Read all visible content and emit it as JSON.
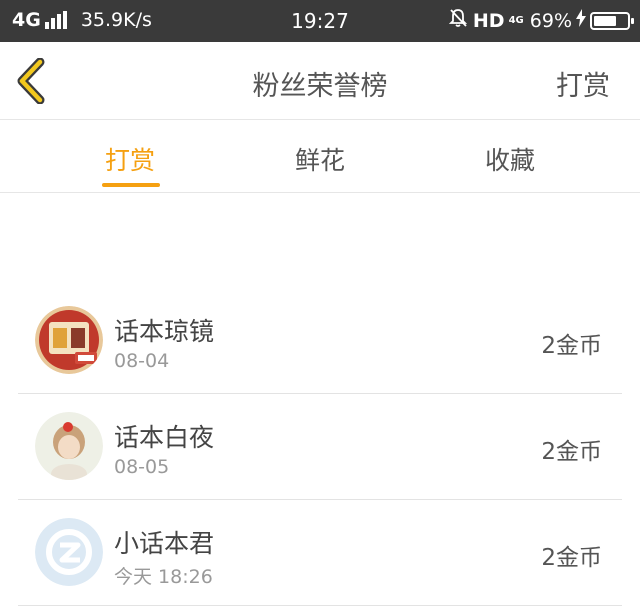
{
  "statusbar": {
    "network": "4G",
    "speed": "35.9K/s",
    "time": "19:27",
    "hd": "HD",
    "network_small": "4G",
    "battery_percent": "69%",
    "battery_level": 0.69
  },
  "header": {
    "title": "粉丝荣誉榜",
    "action_label": "打赏",
    "accent_color": "#f5a011"
  },
  "tabs": [
    {
      "label": "打赏",
      "active": true
    },
    {
      "label": "鲜花",
      "active": false
    },
    {
      "label": "收藏",
      "active": false
    }
  ],
  "list": [
    {
      "name": "话本琼镜",
      "date": "08-04",
      "amount": "2金币",
      "avatar_icon": "book-avatar-icon"
    },
    {
      "name": "话本白夜",
      "date": "08-05",
      "amount": "2金币",
      "avatar_icon": "girl-avatar-icon"
    },
    {
      "name": "小话本君",
      "date": "今天 18:26",
      "amount": "2金币",
      "avatar_icon": "default-avatar-icon"
    }
  ]
}
